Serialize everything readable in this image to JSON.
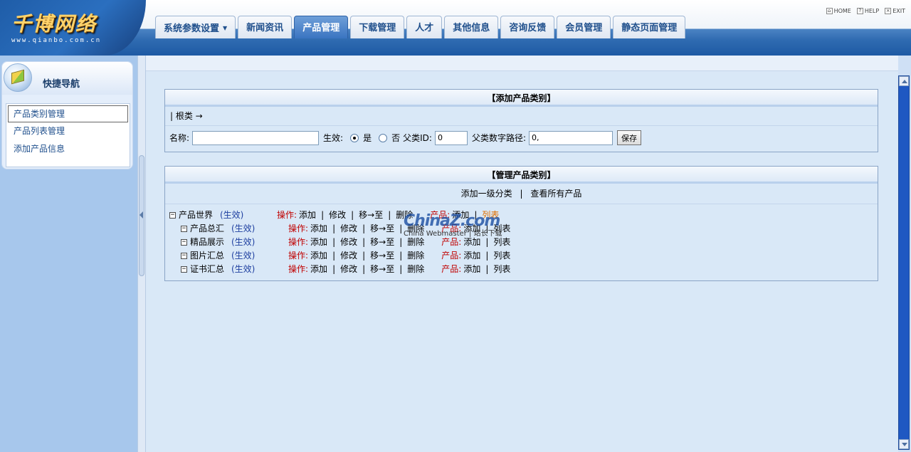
{
  "header": {
    "logo_text": "千博网络",
    "logo_url_text": "www.qianbo.com.cn",
    "tabs": [
      {
        "label": "系统参数设置",
        "has_dropdown": true,
        "active": false
      },
      {
        "label": "新闻资讯",
        "active": false
      },
      {
        "label": "产品管理",
        "active": true
      },
      {
        "label": "下载管理",
        "active": false
      },
      {
        "label": "人才",
        "active": false
      },
      {
        "label": "其他信息",
        "active": false
      },
      {
        "label": "咨询反馈",
        "active": false
      },
      {
        "label": "会员管理",
        "active": false
      },
      {
        "label": "静态页面管理",
        "active": false
      }
    ],
    "top_links": {
      "home": "HOME",
      "help": "HELP",
      "exit": "EXIT"
    }
  },
  "sidebar": {
    "title": "快捷导航",
    "items": [
      {
        "label": "产品类别管理",
        "active": true
      },
      {
        "label": "产品列表管理",
        "active": false
      },
      {
        "label": "添加产品信息",
        "active": false
      }
    ]
  },
  "add_panel": {
    "title": "【添加产品类别】",
    "root_path": "| 根类 →",
    "name_label": "名称:",
    "name_value": "",
    "active_label": "生效:",
    "yes_label": "是",
    "no_label": "否",
    "active_selected": "yes",
    "parent_id_label": "父类ID:",
    "parent_id_value": "0",
    "parent_path_label": "父类数字路径:",
    "parent_path_value": "0,",
    "save_button": "保存"
  },
  "manage_panel": {
    "title": "【管理产品类别】",
    "add_top_link": "添加一级分类",
    "view_all_link": "查看所有产品",
    "separator": "|",
    "op_label": "操作:",
    "prod_label": "产品:",
    "ops": {
      "add": "添加",
      "edit": "修改",
      "move": "移→至",
      "delete": "删除",
      "list": "列表"
    },
    "tree": [
      {
        "name": "产品世界",
        "status": "(生效)",
        "level": 0
      },
      {
        "name": "产品总汇",
        "status": "(生效)",
        "level": 1
      },
      {
        "name": "精品展示",
        "status": "(生效)",
        "level": 1
      },
      {
        "name": "图片汇总",
        "status": "(生效)",
        "level": 1
      },
      {
        "name": "证书汇总",
        "status": "(生效)",
        "level": 1
      }
    ]
  },
  "watermark": {
    "line1": "ChinaZ.com",
    "line2": "China Webmaster | 站长下载"
  },
  "colors": {
    "accent": "#2f6bb1",
    "op_red": "#c00000",
    "status_blue": "#1e3fa0",
    "scrollbar": "#2a62c8"
  }
}
